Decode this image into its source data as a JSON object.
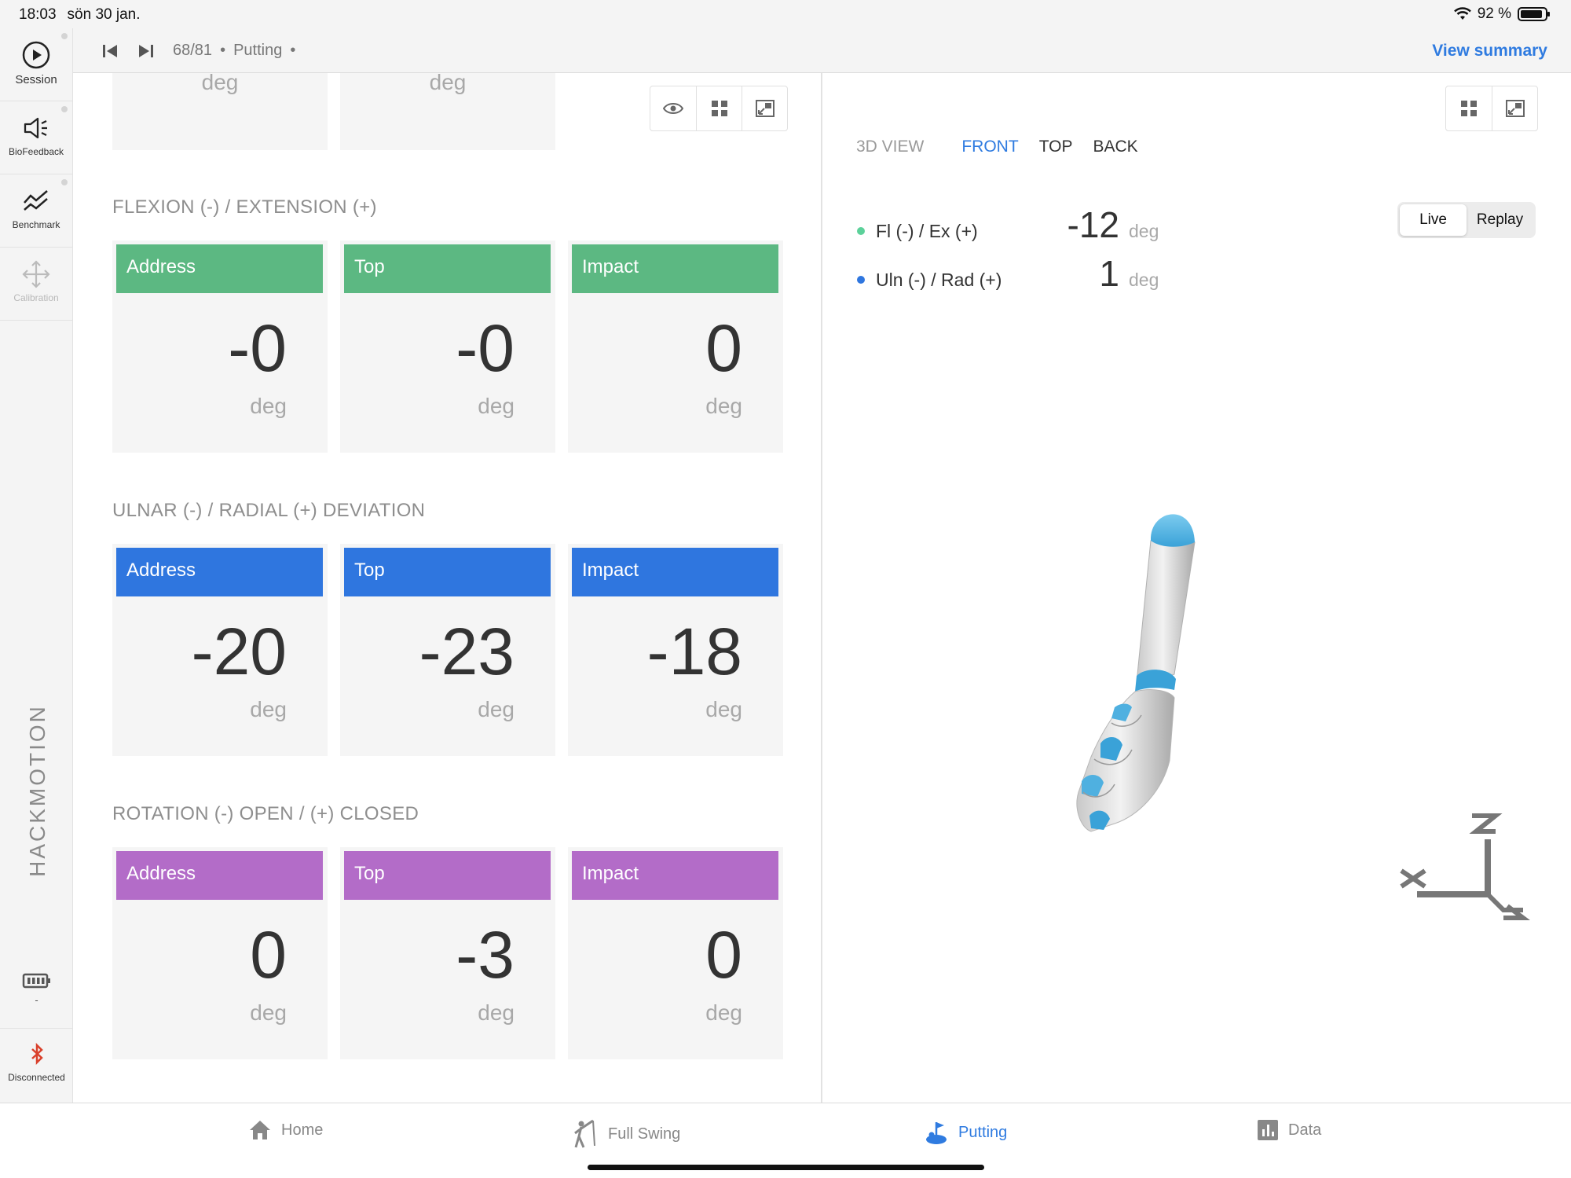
{
  "status_bar": {
    "time": "18:03",
    "date": "sön 30 jan.",
    "battery": "92 %"
  },
  "sidebar": {
    "items": [
      {
        "label": "Session"
      },
      {
        "label": "BioFeedback"
      },
      {
        "label": "Benchmark"
      },
      {
        "label": "Calibration"
      }
    ],
    "brand": "HACKMOTION",
    "sensor_battery": "-",
    "bluetooth_status": "Disconnected"
  },
  "top_nav": {
    "counter": "68/81",
    "mode": "Putting",
    "view_summary": "View summary"
  },
  "top_cards": {
    "unit": "deg"
  },
  "sections": [
    {
      "title": "FLEXION (-) / EXTENSION (+)",
      "color": "#5cb882",
      "cards": [
        {
          "label": "Address",
          "value": "-0",
          "unit": "deg"
        },
        {
          "label": "Top",
          "value": "-0",
          "unit": "deg"
        },
        {
          "label": "Impact",
          "value": "0",
          "unit": "deg"
        }
      ]
    },
    {
      "title": "ULNAR (-) / RADIAL (+) DEVIATION",
      "color": "#2f76df",
      "cards": [
        {
          "label": "Address",
          "value": "-20",
          "unit": "deg"
        },
        {
          "label": "Top",
          "value": "-23",
          "unit": "deg"
        },
        {
          "label": "Impact",
          "value": "-18",
          "unit": "deg"
        }
      ]
    },
    {
      "title": "ROTATION (-) OPEN / (+) CLOSED",
      "color": "#b36cc8",
      "cards": [
        {
          "label": "Address",
          "value": "0",
          "unit": "deg"
        },
        {
          "label": "Top",
          "value": "-3",
          "unit": "deg"
        },
        {
          "label": "Impact",
          "value": "0",
          "unit": "deg"
        }
      ]
    }
  ],
  "view_3d": {
    "label": "3D VIEW",
    "tabs": [
      "FRONT",
      "TOP",
      "BACK"
    ],
    "active_tab": "FRONT",
    "metrics": [
      {
        "name": "Fl (-) / Ex (+)",
        "value": "-12",
        "unit": "deg",
        "color": "#5cd19a"
      },
      {
        "name": "Uln (-) / Rad (+)",
        "value": "1",
        "unit": "deg",
        "color": "#2f76df"
      }
    ],
    "segmented": {
      "live": "Live",
      "replay": "Replay",
      "selected": "Live"
    }
  },
  "tab_bar": {
    "tabs": [
      {
        "label": "Home",
        "icon": "home-icon"
      },
      {
        "label": "Full Swing",
        "icon": "golfer-icon"
      },
      {
        "label": "Putting",
        "icon": "putting-icon"
      },
      {
        "label": "Data",
        "icon": "bar-chart-icon"
      }
    ],
    "active": "Putting"
  }
}
